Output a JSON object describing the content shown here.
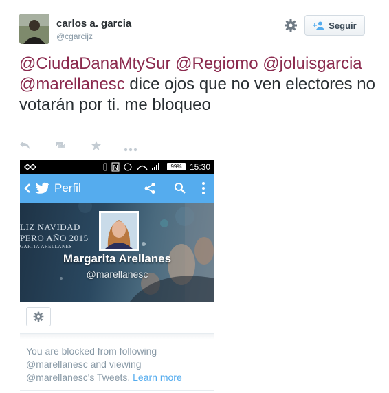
{
  "user": {
    "name": "carlos a. garcia",
    "handle": "@cgarcijz"
  },
  "follow_button": {
    "label": "Seguir"
  },
  "tweet": {
    "mentions": [
      "@CiudaDanaMtySur",
      "@Regiomo",
      "@joluisgarcia",
      "@marellanesc"
    ],
    "text": "dice ojos que no ven electores no votarán por ti. me bloqueo"
  },
  "actions": [
    "reply-icon",
    "retweet-icon",
    "favorite-icon",
    "more-icon"
  ],
  "screenshot": {
    "status_time": "15:30",
    "battery": "99%",
    "app_title": "Perfil",
    "banner_line1": "LIZ NAVIDAD",
    "banner_line2": "PERO AÑO 2015",
    "banner_line3": "GARITA ARELLANES",
    "profile_name": "Margarita Arellanes",
    "profile_handle": "@marellanesc",
    "blocked_message": "You are blocked from following @marellanesc and viewing @marellanesc's Tweets.",
    "learn_more": "Learn more"
  },
  "colors": {
    "mention": "#8b2a4e",
    "twitter_blue": "#55acee",
    "muted": "#8899a6"
  }
}
